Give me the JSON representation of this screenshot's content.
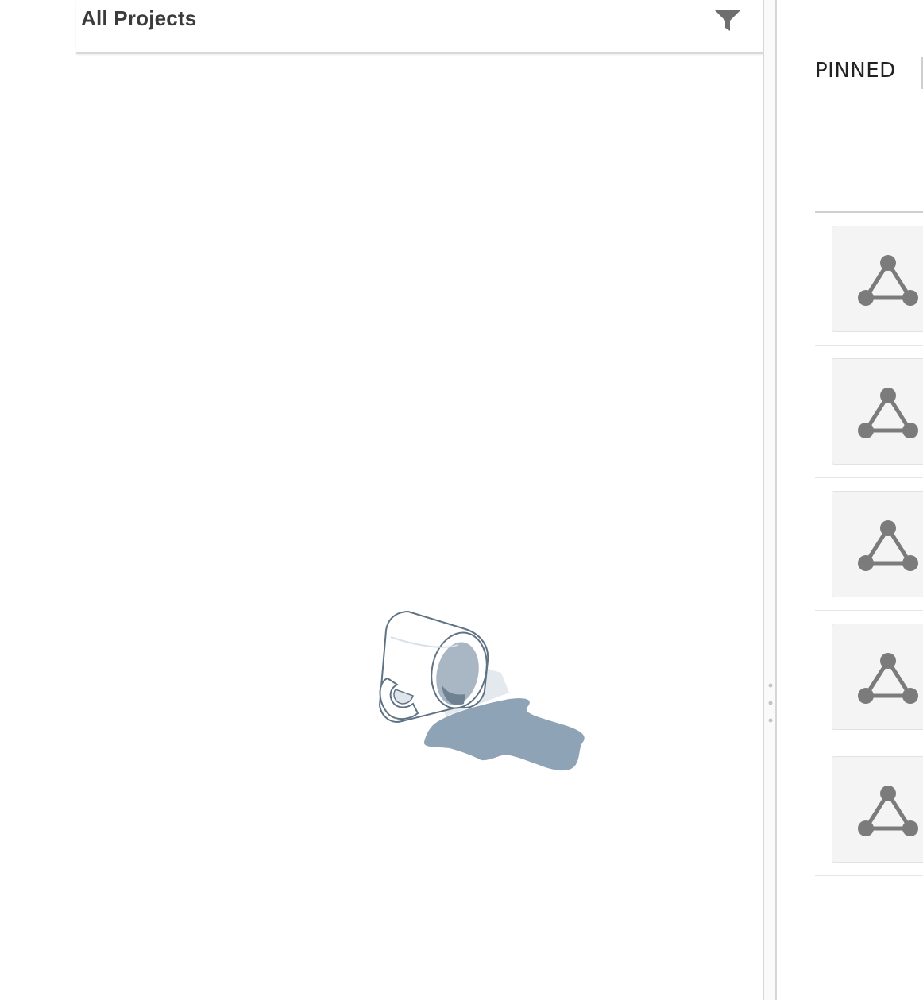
{
  "projects": {
    "title": "All Projects",
    "filter_icon": "filter-icon",
    "empty_state_illustration": "spilled-mug-illustration"
  },
  "pinned": {
    "tab_label": "PINNED",
    "items": [
      {
        "icon": "network-triangle-icon"
      },
      {
        "icon": "network-triangle-icon"
      },
      {
        "icon": "network-triangle-icon"
      },
      {
        "icon": "network-triangle-icon"
      },
      {
        "icon": "network-triangle-icon"
      }
    ]
  },
  "colors": {
    "title_text": "#3b3b3b",
    "icon_gray": "#7b7b7b",
    "spill_blue": "#8fa3b6",
    "thumb_background": "#f4f4f4"
  }
}
